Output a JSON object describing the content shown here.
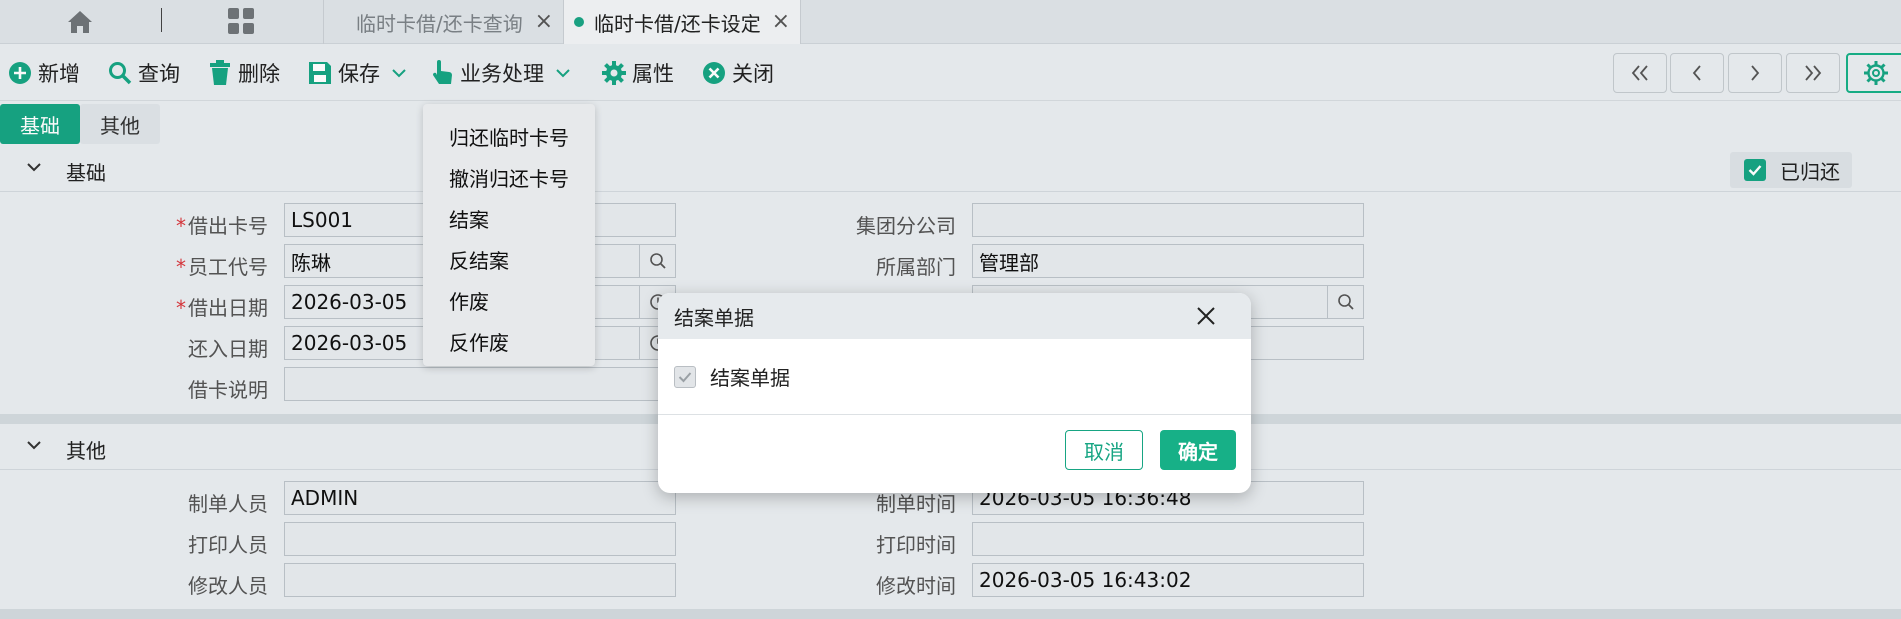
{
  "tabs": [
    {
      "label": "临时卡借/还卡查询"
    },
    {
      "label": "临时卡借/还卡设定"
    }
  ],
  "toolbar": {
    "new": "新增",
    "query": "查询",
    "delete": "删除",
    "save": "保存",
    "business": "业务处理",
    "properties": "属性",
    "close": "关闭"
  },
  "section_tabs": [
    "基础",
    "其他"
  ],
  "panels": {
    "basic": {
      "title": "基础",
      "returned_label": "已归还",
      "fields": {
        "card_no": {
          "label": "借出卡号",
          "value": "LS001"
        },
        "emp_code": {
          "label": "员工代号",
          "value": "陈琳"
        },
        "borrow_date": {
          "label": "借出日期",
          "value": "2026-03-05"
        },
        "return_date": {
          "label": "还入日期",
          "value": "2026-03-05"
        },
        "note": {
          "label": "借卡说明",
          "value": ""
        },
        "group_company": {
          "label": "集团分公司",
          "value": ""
        },
        "dept": {
          "label": "所属部门",
          "value": "管理部"
        }
      }
    },
    "other": {
      "title": "其他",
      "fields": {
        "creator": {
          "label": "制单人员",
          "value": "ADMIN"
        },
        "printer": {
          "label": "打印人员",
          "value": ""
        },
        "modifier": {
          "label": "修改人员",
          "value": ""
        },
        "create_time": {
          "label": "制单时间",
          "value": "2026-03-05 16:36:48"
        },
        "print_time": {
          "label": "打印时间",
          "value": ""
        },
        "modify_time": {
          "label": "修改时间",
          "value": "2026-03-05 16:43:02"
        }
      }
    }
  },
  "business_menu": [
    "归还临时卡号",
    "撤消归还卡号",
    "结案",
    "反结案",
    "作废",
    "反作废"
  ],
  "modal": {
    "title": "结案单据",
    "checkbox_label": "结案单据",
    "cancel": "取消",
    "ok": "确定"
  },
  "colors": {
    "accent": "#17a583",
    "required": "#d9373d"
  }
}
